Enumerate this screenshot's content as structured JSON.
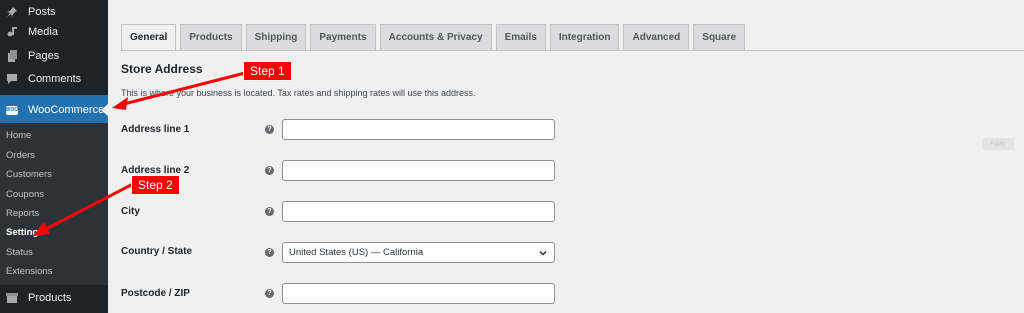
{
  "sidebar": {
    "items": [
      {
        "label": "Posts",
        "icon": "pin-icon"
      },
      {
        "label": "Media",
        "icon": "media-icon"
      },
      {
        "label": "Pages",
        "icon": "pages-icon"
      },
      {
        "label": "Comments",
        "icon": "comment-icon"
      },
      {
        "label": "WooCommerce",
        "icon": "woocommerce-icon"
      }
    ],
    "woo_badge": "WOO",
    "submenu": [
      "Home",
      "Orders",
      "Customers",
      "Coupons",
      "Reports",
      "Settings",
      "Status",
      "Extensions"
    ],
    "current_submenu": "Settings",
    "products": {
      "label": "Products",
      "icon": "products-icon"
    }
  },
  "tabs": [
    "General",
    "Products",
    "Shipping",
    "Payments",
    "Accounts & Privacy",
    "Emails",
    "Integration",
    "Advanced",
    "Square"
  ],
  "active_tab": "General",
  "section": {
    "title": "Store Address",
    "description": "This is where your business is located. Tax rates and shipping rates will use this address."
  },
  "fields": [
    {
      "label": "Address line 1",
      "value": ""
    },
    {
      "label": "Address line 2",
      "value": ""
    },
    {
      "label": "City",
      "value": ""
    },
    {
      "label": "Country / State",
      "value": "United States (US) — California"
    },
    {
      "label": "Postcode / ZIP",
      "value": ""
    }
  ],
  "help_glyph": "?",
  "apply_label": "Apply",
  "annotations": {
    "step1": "Step 1",
    "step2": "Step 2"
  },
  "colors": {
    "accent": "#2271b1",
    "sidebar": "#1d2327",
    "annotation": "#ff0000"
  }
}
